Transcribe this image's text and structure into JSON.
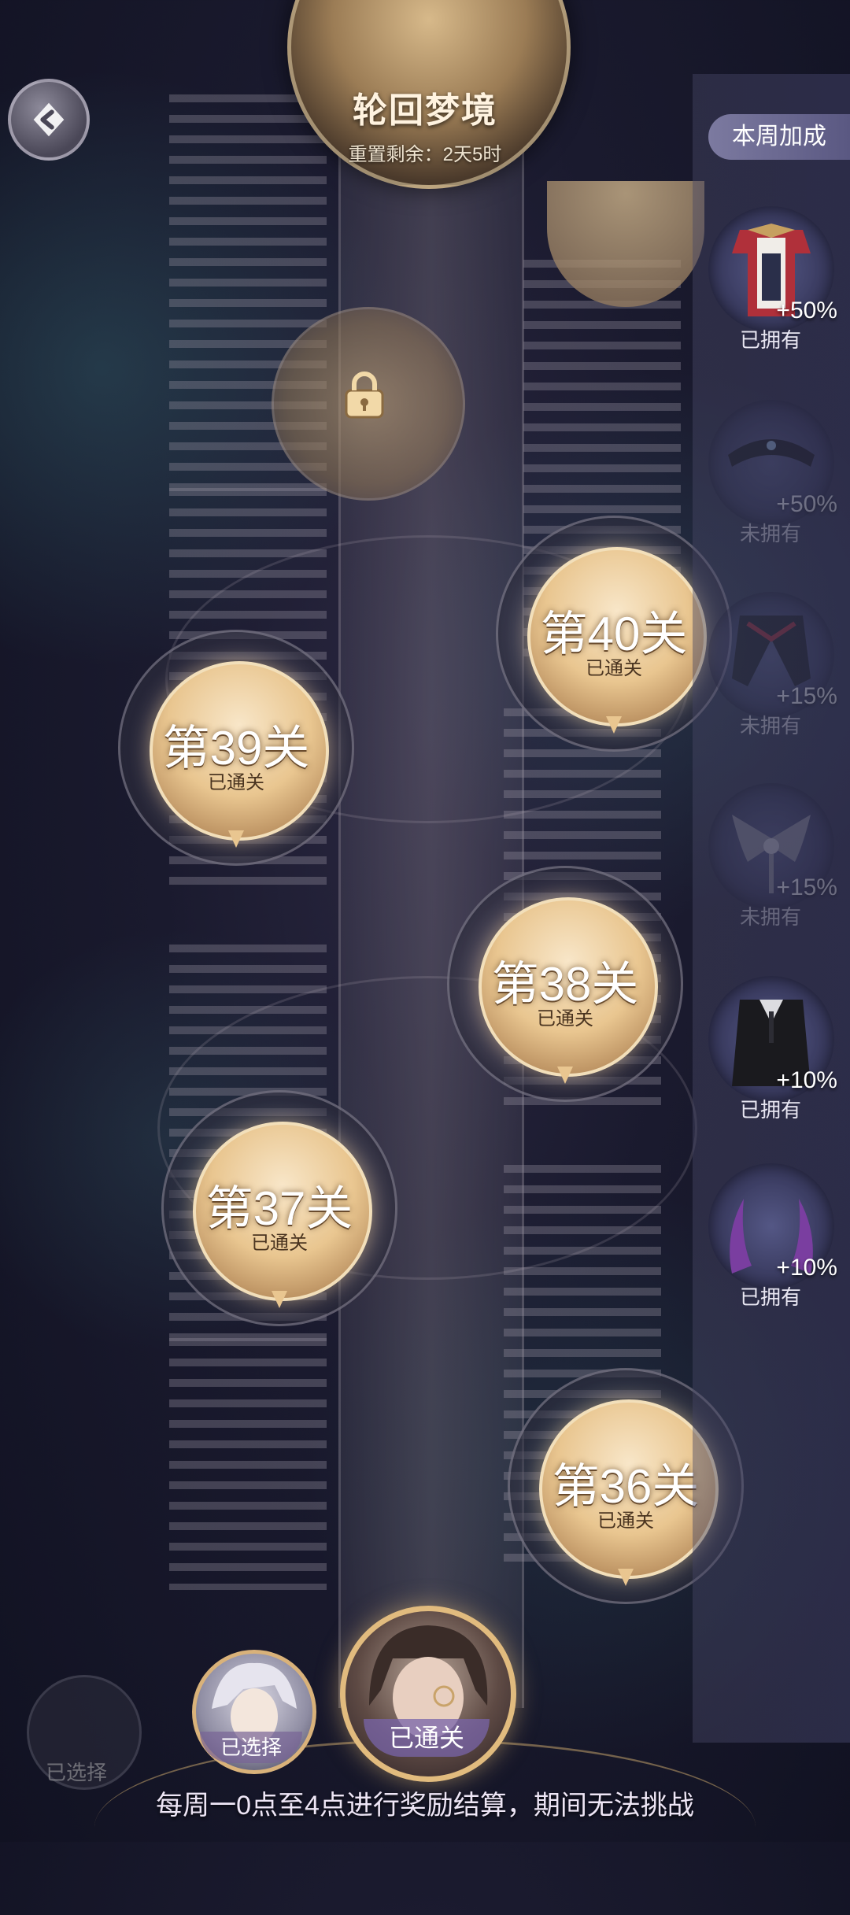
{
  "header": {
    "title": "轮回梦境",
    "reset_text": "重置剩余：2天5时"
  },
  "side_panel": {
    "title": "本周加成",
    "bonuses": [
      {
        "icon": "red-coat-outfit-icon",
        "percent": "+50%",
        "status": "已拥有",
        "owned": true
      },
      {
        "icon": "headdress-icon",
        "percent": "+50%",
        "status": "未拥有",
        "owned": false
      },
      {
        "icon": "cape-collar-icon",
        "percent": "+15%",
        "status": "未拥有",
        "owned": false
      },
      {
        "icon": "bat-wing-ornament-icon",
        "percent": "+15%",
        "status": "未拥有",
        "owned": false
      },
      {
        "icon": "black-suit-icon",
        "percent": "+10%",
        "status": "已拥有",
        "owned": true
      },
      {
        "icon": "purple-horns-icon",
        "percent": "+10%",
        "status": "已拥有",
        "owned": true
      }
    ]
  },
  "levels": [
    {
      "title": "第40关",
      "status": "已通关"
    },
    {
      "title": "第39关",
      "status": "已通关"
    },
    {
      "title": "第38关",
      "status": "已通关"
    },
    {
      "title": "第37关",
      "status": "已通关"
    },
    {
      "title": "第36关",
      "status": "已通关"
    }
  ],
  "characters": {
    "ghost_label": "已选择",
    "selected_label": "已选择",
    "current_label": "已通关"
  },
  "footer": {
    "note": "每周一0点至4点进行奖励结算，期间无法挑战"
  }
}
